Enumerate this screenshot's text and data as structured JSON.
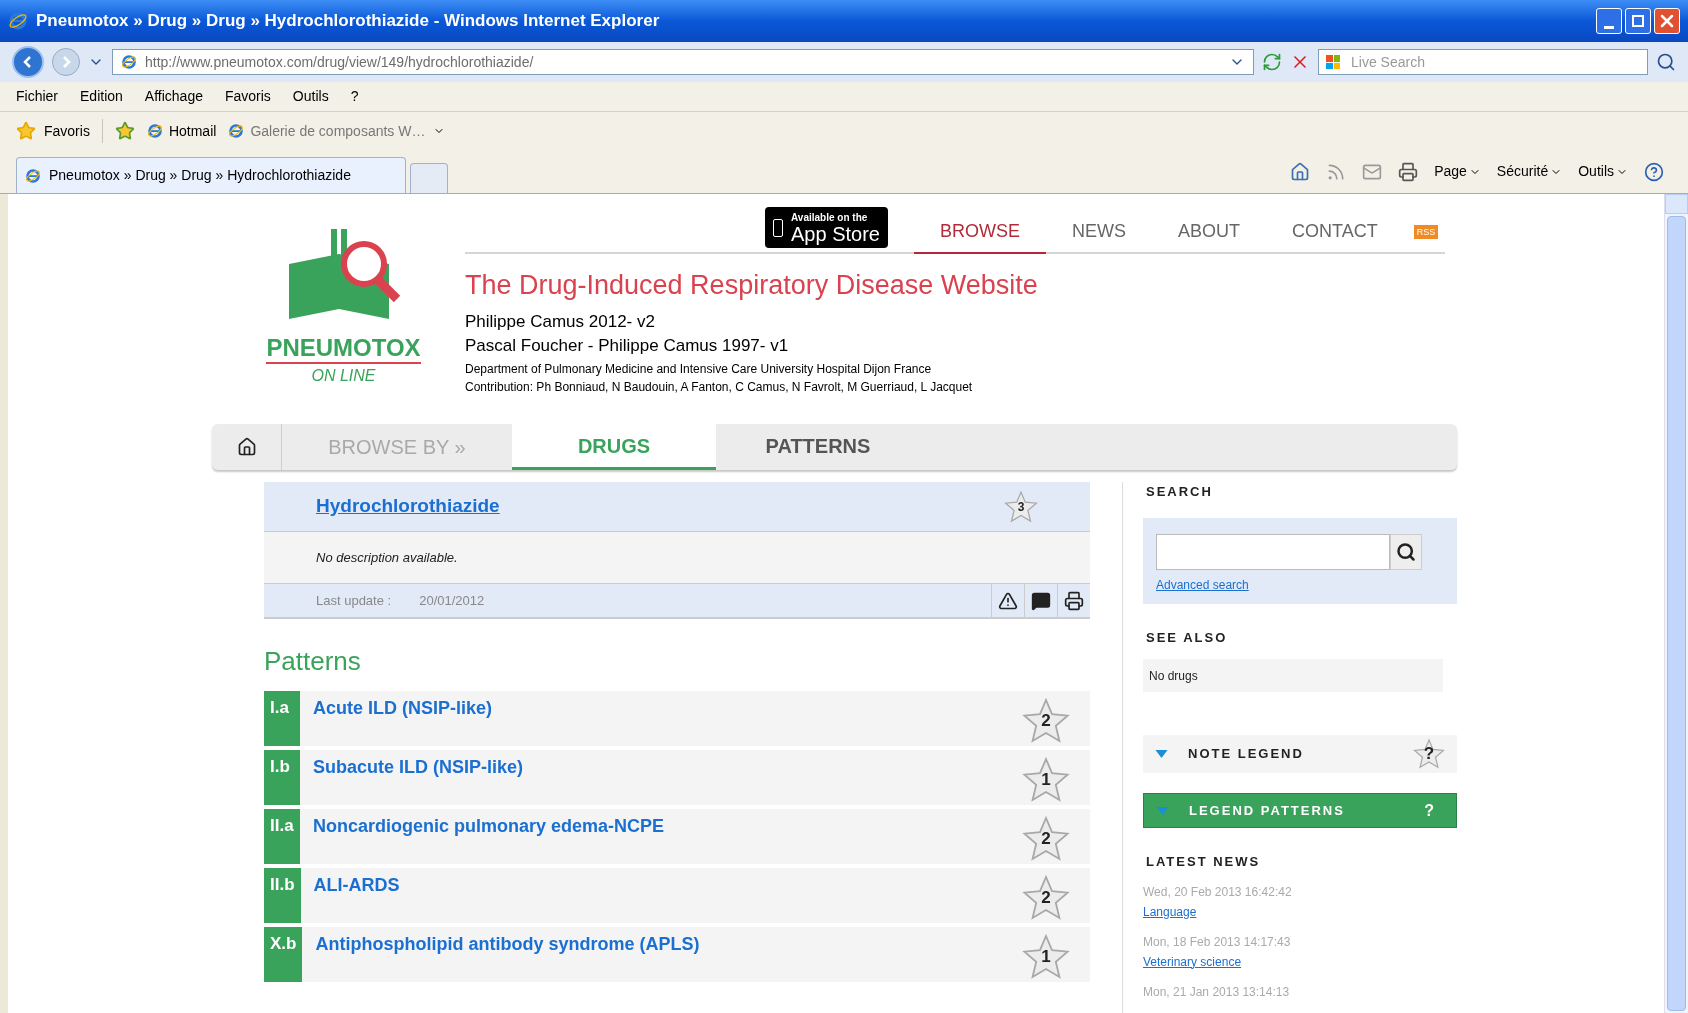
{
  "window": {
    "title": "Pneumotox » Drug » Drug » Hydrochlorothiazide - Windows Internet Explorer"
  },
  "address_bar": {
    "url": "http://www.pneumotox.com/drug/view/149/hydrochlorothiazide/"
  },
  "live_search": {
    "placeholder": "Live Search"
  },
  "menu": [
    "Fichier",
    "Edition",
    "Affichage",
    "Favoris",
    "Outils",
    "?"
  ],
  "favorites_bar": {
    "favorites": "Favoris",
    "links": [
      "Hotmail",
      "Galerie de composants W…"
    ]
  },
  "browser_tabs": [
    {
      "title": "Pneumotox » Drug » Drug » Hydrochlorothiazide",
      "selected": true
    }
  ],
  "command_bar": [
    "Page",
    "Sécurité",
    "Outils"
  ],
  "site": {
    "logo": {
      "name": "PNEUMOTOX",
      "tagline": "ON LINE"
    },
    "app_store": {
      "small": "Available on the",
      "large": "App Store"
    },
    "nav": [
      {
        "label": "BROWSE",
        "selected": true
      },
      {
        "label": "NEWS",
        "selected": false
      },
      {
        "label": "ABOUT",
        "selected": false
      },
      {
        "label": "CONTACT",
        "selected": false
      }
    ],
    "rss": "RSS",
    "title": "The Drug-Induced Respiratory Disease Website",
    "authors": [
      "Philippe Camus 2012- v2",
      "Pascal Foucher - Philippe Camus 1997- v1"
    ],
    "department": "Department of Pulmonary Medicine and Intensive Care University Hospital Dijon France",
    "contribution": "Contribution: Ph Bonniaud, N Baudouin, A Fanton, C Camus, N Favrolt, M Guerriaud, L Jacquet",
    "browse_by": "BROWSE BY »",
    "browse_tabs": [
      {
        "label": "DRUGS",
        "selected": true
      },
      {
        "label": "PATTERNS",
        "selected": false
      }
    ]
  },
  "drug": {
    "name": "Hydrochlorothiazide",
    "rating": "3",
    "description": "No description available.",
    "last_update_label": "Last update :",
    "last_update": "20/01/2012"
  },
  "patterns": {
    "heading": "Patterns",
    "rows": [
      {
        "code": "I.a",
        "name": "Acute ILD (NSIP-like)",
        "rating": "2"
      },
      {
        "code": "I.b",
        "name": "Subacute ILD (NSIP-like)",
        "rating": "1"
      },
      {
        "code": "II.a",
        "name": "Noncardiogenic pulmonary edema-NCPE",
        "rating": "2"
      },
      {
        "code": "II.b",
        "name": "ALI-ARDS",
        "rating": "2"
      },
      {
        "code": "X.b",
        "name": "Antiphospholipid antibody syndrome (APLS)",
        "rating": "1"
      }
    ]
  },
  "sidebar": {
    "search_heading": "SEARCH",
    "advanced_search": "Advanced search",
    "see_also_heading": "SEE ALSO",
    "see_also": "No drugs",
    "note_legend": {
      "label": "NOTE LEGEND",
      "help": "?"
    },
    "legend_patterns": {
      "label": "LEGEND PATTERNS",
      "help": "?"
    },
    "latest_news_heading": "LATEST NEWS",
    "news": [
      {
        "date": "Wed, 20 Feb 2013 16:42:42",
        "title": "Language"
      },
      {
        "date": "Mon, 18 Feb 2013 14:17:43",
        "title": "Veterinary science"
      },
      {
        "date": "Mon, 21 Jan 2013 13:14:13"
      }
    ]
  }
}
